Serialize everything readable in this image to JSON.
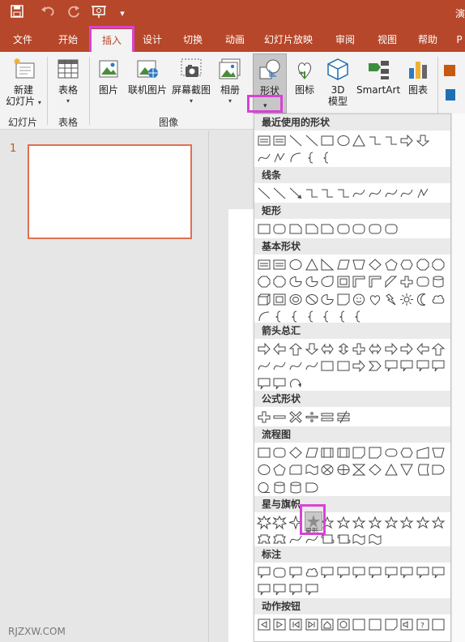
{
  "app": {
    "title_edge": "演",
    "qat": [
      {
        "icon": "save-icon"
      },
      {
        "icon": "undo-icon"
      },
      {
        "icon": "redo-icon"
      },
      {
        "icon": "present-icon"
      },
      {
        "icon": "customize-icon"
      }
    ]
  },
  "tabs": [
    "文件",
    "开始",
    "插入",
    "设计",
    "切换",
    "动画",
    "幻灯片放映",
    "审阅",
    "视图",
    "帮助",
    "P"
  ],
  "active_tab": "插入",
  "ribbon": {
    "groups": {
      "slides": "幻灯片",
      "tables": "表格",
      "images": "图像"
    },
    "buttons": {
      "new_slide": "新建",
      "new_slide_2": "幻灯片",
      "table": "表格",
      "picture": "图片",
      "online_picture": "联机图片",
      "screenshot": "屏幕截图",
      "album": "相册",
      "shapes": "形状",
      "icons": "图标",
      "model3d": "3D",
      "model3d_2": "模型",
      "smartart": "SmartArt",
      "chart": "图表"
    }
  },
  "slide_panel": {
    "slide_number": "1"
  },
  "shapes_menu": {
    "sections": [
      {
        "title": "最近使用的形状",
        "rows": [
          [
            "textbox",
            "vtextbox",
            "line",
            "arrow-line",
            "rect",
            "oval",
            "triangle",
            "elbow",
            "elbow-arrow",
            "right-arrow",
            "down-arrow"
          ],
          [
            "curly",
            "freeform",
            "arc",
            "brace-l",
            "brace-r"
          ]
        ]
      },
      {
        "title": "线条",
        "rows": [
          [
            "line",
            "arrow-line",
            "double-arrow",
            "elbow",
            "elbow-arrow",
            "elbow-double",
            "curve",
            "curve-arrow",
            "curve-double",
            "scribble",
            "freeform"
          ]
        ]
      },
      {
        "title": "矩形",
        "rows": [
          [
            "rect",
            "rounded",
            "snip1",
            "snip2",
            "snip-diag",
            "round-snip",
            "round1",
            "round2",
            "round-diag"
          ]
        ]
      },
      {
        "title": "基本形状",
        "rows": [
          [
            "textbox",
            "vtextbox",
            "oval",
            "triangle",
            "right-tri",
            "parallelogram",
            "trapezoid",
            "diamond",
            "pentagon",
            "hexagon",
            "heptagon",
            "octagon"
          ],
          [
            "decagon",
            "dodecagon",
            "pie",
            "chord",
            "teardrop",
            "frame",
            "half-frame",
            "l-shape",
            "diag-stripe",
            "cross",
            "plaque",
            "can"
          ],
          [
            "cube",
            "bevel",
            "donut",
            "no-symbol",
            "block-arc",
            "folded",
            "smiley",
            "heart",
            "lightning",
            "sun",
            "moon",
            "cloud"
          ],
          [
            "arc",
            "double-bracket",
            "double-brace",
            "bracket-l",
            "bracket-r",
            "brace-l",
            "brace-r"
          ]
        ]
      },
      {
        "title": "箭头总汇",
        "rows": [
          [
            "right-arrow",
            "left-arrow",
            "up-arrow",
            "down-arrow",
            "lr-arrow",
            "ud-arrow",
            "quad-arrow",
            "lru-arrow",
            "bent-arrow",
            "u-turn",
            "left-up-arrow",
            "bent-up-arrow"
          ],
          [
            "curved-right",
            "curved-left",
            "curved-up",
            "curved-down",
            "striped-right",
            "notched-right",
            "pentagon-arrow",
            "chevron",
            "right-callout",
            "down-callout",
            "left-callout",
            "up-callout"
          ],
          [
            "lr-callout",
            "quad-callout",
            "circular-arrow"
          ]
        ]
      },
      {
        "title": "公式形状",
        "rows": [
          [
            "plus",
            "minus",
            "multiply",
            "divide",
            "equal",
            "not-equal"
          ]
        ]
      },
      {
        "title": "流程图",
        "rows": [
          [
            "fc-process",
            "fc-alt",
            "fc-decision",
            "fc-data",
            "fc-predefined",
            "fc-internal",
            "fc-document",
            "fc-multidoc",
            "fc-terminator",
            "fc-prep",
            "fc-manual-input",
            "fc-manual-op"
          ],
          [
            "fc-connector",
            "fc-offpage",
            "fc-card",
            "fc-tape",
            "fc-summing",
            "fc-or",
            "fc-collate",
            "fc-sort",
            "fc-extract",
            "fc-merge",
            "fc-stored",
            "fc-delay"
          ],
          [
            "fc-sequential",
            "fc-magnetic-disk",
            "fc-direct",
            "fc-display"
          ]
        ]
      },
      {
        "title": "星与旗帜",
        "rows": [
          [
            "explosion1",
            "explosion2",
            "star4",
            "star5",
            "star6",
            "star7",
            "star8",
            "star10",
            "star12",
            "star16",
            "star24",
            "star32"
          ],
          [
            "ribbon-up",
            "ribbon-down",
            "curved-ribbon-up",
            "curved-ribbon-down",
            "scroll-v",
            "scroll-h",
            "wave",
            "double-wave"
          ]
        ]
      },
      {
        "title": "标注",
        "rows": [
          [
            "rect-callout",
            "round-callout",
            "oval-callout",
            "cloud-callout",
            "line-callout1",
            "line-callout2",
            "line-callout3",
            "line-callout-acc1",
            "line-callout-acc2",
            "line-callout-acc3",
            "line-callout-border1",
            "line-callout-border2"
          ],
          [
            "line-callout-border3",
            "line-callout-ab1",
            "line-callout-ab2",
            "line-callout-ab3"
          ]
        ]
      },
      {
        "title": "动作按钮",
        "rows": [
          [
            "btn-back",
            "btn-forward",
            "btn-beginning",
            "btn-end",
            "btn-home",
            "btn-info",
            "btn-return",
            "btn-movie",
            "btn-document",
            "btn-sound",
            "btn-help",
            "btn-blank"
          ]
        ]
      }
    ],
    "selected_shape": "star5",
    "selected_label": "星形"
  },
  "watermark": "RJZXW.COM",
  "colors": {
    "brand": "#b7472a",
    "highlight": "#d942d6",
    "slide_border": "#e07050"
  }
}
